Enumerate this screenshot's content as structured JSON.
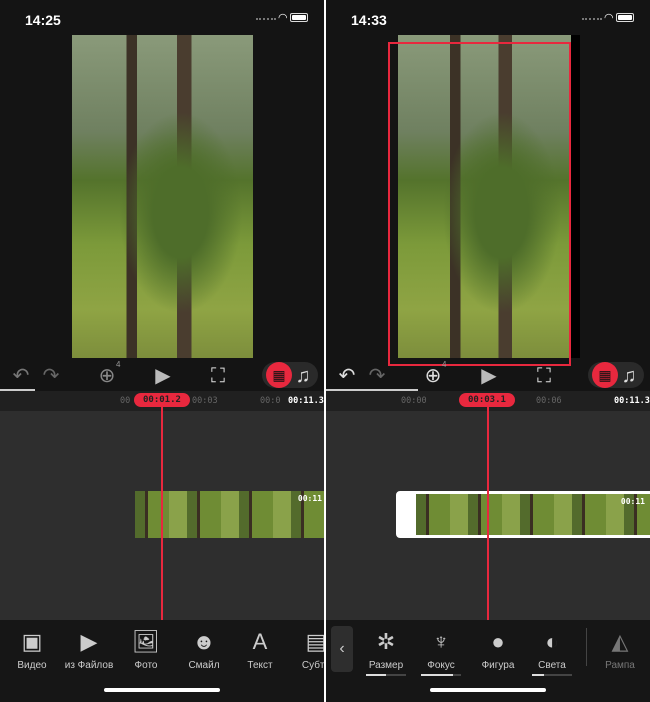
{
  "screens": [
    {
      "time": "14:25",
      "timeline": {
        "current": "00:01.2",
        "ticks": [
          "00",
          "00:03",
          "00:0"
        ],
        "end": "00:11.3",
        "clip_duration": "00:11",
        "clip_selected": false
      },
      "clip_count_badge": "4",
      "tools": [
        {
          "label": "Видео",
          "icon": "video-icon",
          "glyph": "▣"
        },
        {
          "label": "из Файлов",
          "icon": "folder-play-icon",
          "glyph": "▶"
        },
        {
          "label": "Фото",
          "icon": "photo-icon",
          "glyph": "🖼"
        },
        {
          "label": "Смайл",
          "icon": "emoji-icon",
          "glyph": "☻"
        },
        {
          "label": "Текст",
          "icon": "text-icon",
          "glyph": "A"
        },
        {
          "label": "Субти",
          "icon": "subtitles-icon",
          "glyph": "▤"
        }
      ]
    },
    {
      "time": "14:33",
      "timeline": {
        "current": "00:03.1",
        "ticks": [
          "00:00",
          "00:06"
        ],
        "end": "00:11.3",
        "clip_duration": "00:11",
        "clip_selected": true
      },
      "clip_count_badge": "4",
      "tools": [
        {
          "label": "Размер",
          "icon": "aperture-icon",
          "glyph": "✲",
          "slider": 0.5
        },
        {
          "label": "Фокус",
          "icon": "tulip-icon",
          "glyph": "♆",
          "slider": 0.8
        },
        {
          "label": "Фигура",
          "icon": "circle-icon",
          "glyph": "●"
        },
        {
          "label": "Света",
          "icon": "light-icon",
          "glyph": "◐",
          "slider": 0.3
        },
        {
          "label": "Рампа",
          "icon": "ramp-icon",
          "glyph": "◭",
          "dim": true
        }
      ]
    }
  ],
  "colors": {
    "accent": "#e8283e",
    "background": "#141414",
    "timeline": "#2e2e2e"
  }
}
